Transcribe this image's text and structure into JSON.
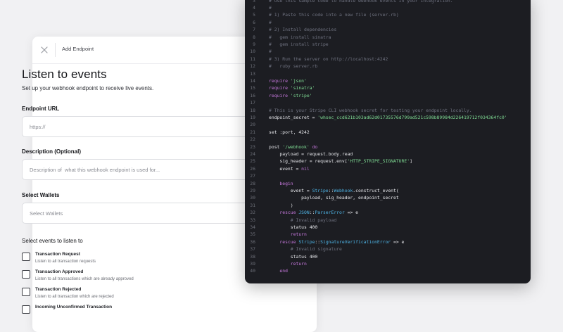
{
  "form": {
    "header_title": "Add Endpoint",
    "title": "Listen to events",
    "subtitle": "Set up your webhook endpoint to receive live events.",
    "endpoint_url": {
      "label": "Endpoint URL",
      "placeholder": "https://"
    },
    "description": {
      "label": "Description (Optional)",
      "placeholder": "Description of  what this webhook endpoint is used for..."
    },
    "wallets": {
      "label": "Select Wallets",
      "selected": "Select Wallets"
    },
    "events_label": "Select events to listen to",
    "events": [
      {
        "title": "Transaction Request",
        "desc": "Listen to all transaction requests"
      },
      {
        "title": "Transaction Approved",
        "desc": "Listen to all transactions which are already approved"
      },
      {
        "title": "Transaction Rejected",
        "desc": "Listen to all transaction which are rejected"
      },
      {
        "title": "Incoming Unconfirmed Transaction",
        "desc": ""
      }
    ]
  },
  "code": {
    "lines": [
      {
        "n": "3",
        "tokens": [
          {
            "t": "# Use this sample code to handle webhook events in your integration.",
            "c": "comment"
          }
        ]
      },
      {
        "n": "4",
        "tokens": [
          {
            "t": "#",
            "c": "comment"
          }
        ]
      },
      {
        "n": "5",
        "tokens": [
          {
            "t": "# 1) Paste this code into a new file (server.rb)",
            "c": "comment"
          }
        ]
      },
      {
        "n": "6",
        "tokens": [
          {
            "t": "#",
            "c": "comment"
          }
        ]
      },
      {
        "n": "7",
        "tokens": [
          {
            "t": "# 2) Install dependencies",
            "c": "comment"
          }
        ]
      },
      {
        "n": "8",
        "tokens": [
          {
            "t": "#   gem install sinatra",
            "c": "comment"
          }
        ]
      },
      {
        "n": "9",
        "tokens": [
          {
            "t": "#   gem install stripe",
            "c": "comment"
          }
        ]
      },
      {
        "n": "10",
        "tokens": [
          {
            "t": "#",
            "c": "comment"
          }
        ]
      },
      {
        "n": "11",
        "tokens": [
          {
            "t": "# 3) Run the server on http://localhost:4242",
            "c": "comment"
          }
        ]
      },
      {
        "n": "12",
        "tokens": [
          {
            "t": "#   ruby server.rb",
            "c": "comment"
          }
        ]
      },
      {
        "n": "13",
        "tokens": []
      },
      {
        "n": "14",
        "tokens": [
          {
            "t": "require ",
            "c": "kw"
          },
          {
            "t": "'json'",
            "c": "str"
          }
        ]
      },
      {
        "n": "15",
        "tokens": [
          {
            "t": "require ",
            "c": "kw"
          },
          {
            "t": "'sinatra'",
            "c": "str"
          }
        ]
      },
      {
        "n": "16",
        "tokens": [
          {
            "t": "require ",
            "c": "kw"
          },
          {
            "t": "'stripe'",
            "c": "str"
          }
        ]
      },
      {
        "n": "17",
        "tokens": []
      },
      {
        "n": "18",
        "tokens": [
          {
            "t": "# This is your Stripe CLI webhook secret for testing your endpoint locally.",
            "c": "comment"
          }
        ]
      },
      {
        "n": "19",
        "tokens": [
          {
            "t": "endpoint_secret = ",
            "c": "plain"
          },
          {
            "t": "'whsec_ccd621b103ad62d01735576d799ad521c598b89984d226419712f034364fc0'",
            "c": "str"
          }
        ]
      },
      {
        "n": "20",
        "tokens": []
      },
      {
        "n": "21",
        "tokens": [
          {
            "t": "set :port, 4242",
            "c": "plain"
          }
        ]
      },
      {
        "n": "22",
        "tokens": []
      },
      {
        "n": "23",
        "tokens": [
          {
            "t": "post ",
            "c": "plain"
          },
          {
            "t": "'/webhook'",
            "c": "str"
          },
          {
            "t": " do",
            "c": "kw"
          }
        ]
      },
      {
        "n": "24",
        "tokens": [
          {
            "t": "    payload = request.body.read",
            "c": "plain"
          }
        ]
      },
      {
        "n": "25",
        "tokens": [
          {
            "t": "    sig_header = request.env[",
            "c": "plain"
          },
          {
            "t": "'HTTP_STRIPE_SIGNATURE'",
            "c": "str"
          },
          {
            "t": "]",
            "c": "plain"
          }
        ]
      },
      {
        "n": "26",
        "tokens": [
          {
            "t": "    event = ",
            "c": "plain"
          },
          {
            "t": "nil",
            "c": "kw"
          }
        ]
      },
      {
        "n": "27",
        "tokens": []
      },
      {
        "n": "28",
        "tokens": [
          {
            "t": "    begin",
            "c": "kw"
          }
        ]
      },
      {
        "n": "29",
        "tokens": [
          {
            "t": "        event = ",
            "c": "plain"
          },
          {
            "t": "Stripe",
            "c": "const"
          },
          {
            "t": "::",
            "c": "plain"
          },
          {
            "t": "Webhook",
            "c": "const"
          },
          {
            "t": ".construct_event(",
            "c": "plain"
          }
        ]
      },
      {
        "n": "30",
        "tokens": [
          {
            "t": "            payload, sig_header, endpoint_secret",
            "c": "plain"
          }
        ]
      },
      {
        "n": "31",
        "tokens": [
          {
            "t": "        )",
            "c": "plain"
          }
        ]
      },
      {
        "n": "32",
        "tokens": [
          {
            "t": "    rescue ",
            "c": "kw"
          },
          {
            "t": "JSON",
            "c": "const"
          },
          {
            "t": "::",
            "c": "plain"
          },
          {
            "t": "ParserError",
            "c": "const"
          },
          {
            "t": " => e",
            "c": "plain"
          }
        ]
      },
      {
        "n": "33",
        "tokens": [
          {
            "t": "        # Invalid payload",
            "c": "comment"
          }
        ]
      },
      {
        "n": "34",
        "tokens": [
          {
            "t": "        status 400",
            "c": "plain"
          }
        ]
      },
      {
        "n": "35",
        "tokens": [
          {
            "t": "        return",
            "c": "kw"
          }
        ]
      },
      {
        "n": "36",
        "tokens": [
          {
            "t": "    rescue ",
            "c": "kw"
          },
          {
            "t": "Stripe",
            "c": "const"
          },
          {
            "t": "::",
            "c": "plain"
          },
          {
            "t": "SignatureVerificationError",
            "c": "const"
          },
          {
            "t": " => e",
            "c": "plain"
          }
        ]
      },
      {
        "n": "37",
        "tokens": [
          {
            "t": "        # Invalid signature",
            "c": "comment"
          }
        ]
      },
      {
        "n": "38",
        "tokens": [
          {
            "t": "        status 400",
            "c": "plain"
          }
        ]
      },
      {
        "n": "39",
        "tokens": [
          {
            "t": "        return",
            "c": "kw"
          }
        ]
      },
      {
        "n": "40",
        "tokens": [
          {
            "t": "    end",
            "c": "kw"
          }
        ]
      }
    ]
  }
}
